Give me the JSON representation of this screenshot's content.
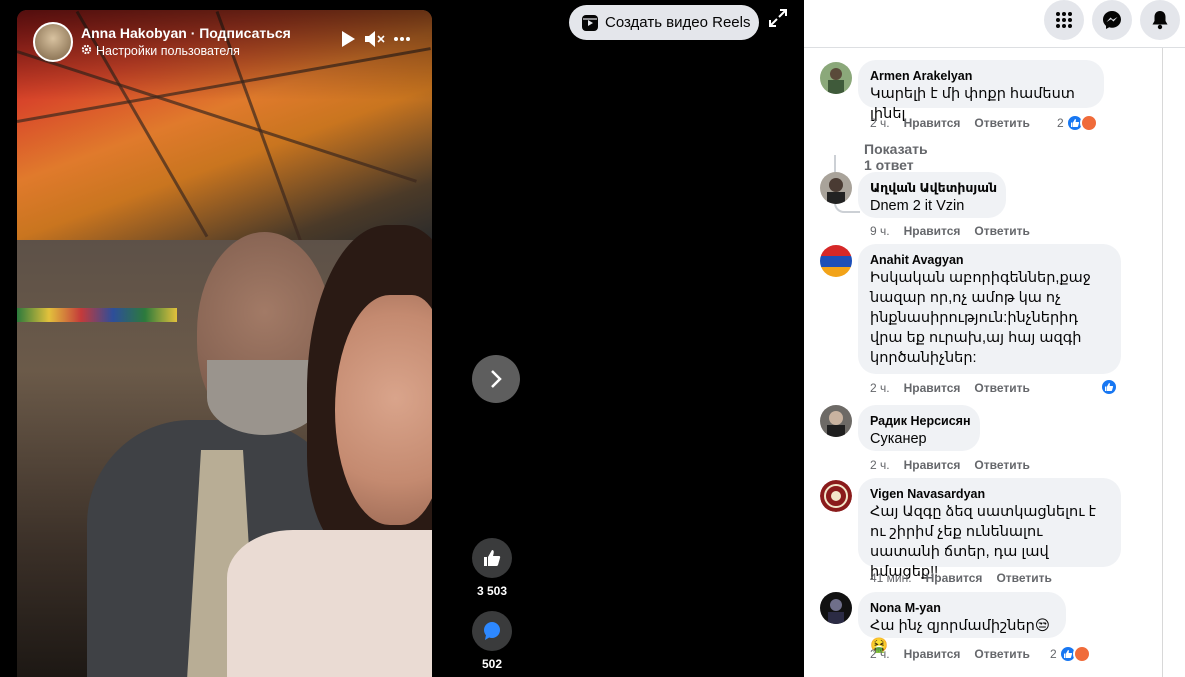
{
  "video": {
    "author": "Anna Hakobyan · Подписаться",
    "settings_label": "Настройки пользователя"
  },
  "toolbar": {
    "create_reels_label": "Создать видео Reels"
  },
  "actions": {
    "likes_count": "3 503",
    "comments_count": "502"
  },
  "colors": {
    "accent": "#1877f2",
    "bubble": "#f0f2f5",
    "muted_text": "#65676b"
  },
  "comments": [
    {
      "name": "Armen Arakelyan",
      "text": "Կարելի է մի փոքր համեստ լինել",
      "time": "2 ч.",
      "like_label": "Нравится",
      "reply_label": "Ответить",
      "reactions_count": "2",
      "reply_link": "Показать 1 ответ"
    },
    {
      "name": "Աղվան Ավետիսյան",
      "text": "Dnem 2 it Vzin",
      "time": "9 ч.",
      "like_label": "Нравится",
      "reply_label": "Ответить"
    },
    {
      "name": "Anahit Avagyan",
      "text": "Իսկական աբորիգեններ,քաջ նազար որ,ոչ ամոթ կա ոչ ինքնասիրություն:ինչներիդ վրա եք ուրախ,այ հայ ազգի կործանիչներ:",
      "time": "2 ч.",
      "like_label": "Нравится",
      "reply_label": "Ответить"
    },
    {
      "name": "Радик Нерсисян",
      "text": "Суканер",
      "time": "2 ч.",
      "like_label": "Нравится",
      "reply_label": "Ответить"
    },
    {
      "name": "Vigen Navasardyan",
      "text": "Հայ Ազգը ձեզ սատկացնելու է ու շիրիմ չեք ունենալու սատանի ճտեր, դա լավ իմացեք!!",
      "time": "41 мин.",
      "like_label": "Нравится",
      "reply_label": "Ответить"
    },
    {
      "name": "Nona M-yan",
      "text": "Հա ինչ զյորմամիշներ😒🤮",
      "time": "2 ч.",
      "like_label": "Нравится",
      "reply_label": "Ответить",
      "reactions_count": "2"
    }
  ]
}
